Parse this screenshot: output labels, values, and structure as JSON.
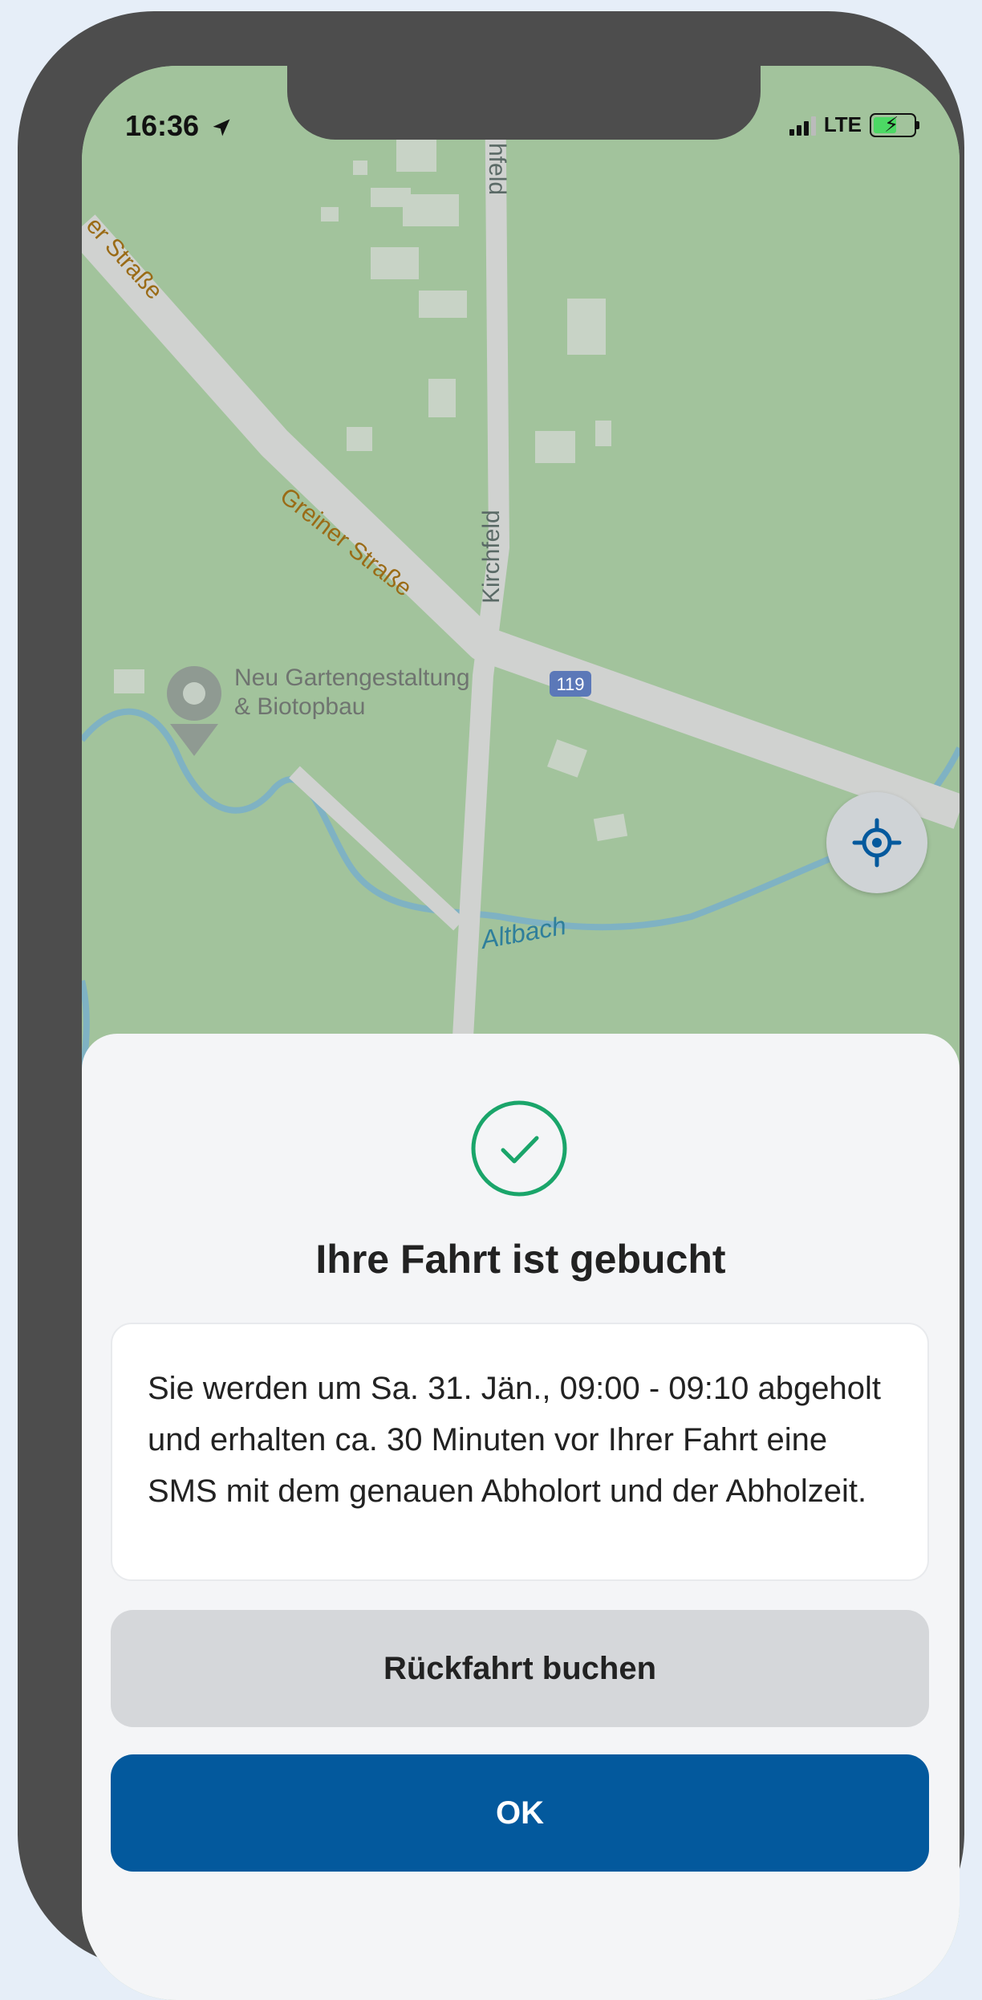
{
  "status_bar": {
    "time": "16:36",
    "network": "LTE"
  },
  "map": {
    "labels": {
      "street_1": "er Straße",
      "street_2": "Greiner Straße",
      "street_3": "Kirchfeld",
      "street_4": "hfeld",
      "poi_line1": "Neu Gartengestaltung",
      "poi_line2": "& Biotopbau",
      "route_badge": "119",
      "creek": "Altbach"
    },
    "colors": {
      "land": "#a2c39c",
      "road": "#d0d2d0",
      "water": "#7fb2c3",
      "building": "#c8d3c6"
    }
  },
  "icons": {
    "locate": "crosshair-location-icon",
    "success": "check-circle-icon",
    "location_arrow": "location-arrow-icon"
  },
  "confirmation": {
    "title": "Ihre Fahrt ist gebucht",
    "message": "Sie werden um Sa. 31. Jän., 09:00 - 09:10 abgeholt und erhalten ca. 30 Minuten vor Ihrer Fahrt eine SMS mit dem genauen Abholort und der Abholzeit."
  },
  "buttons": {
    "return_trip": "Rückfahrt buchen",
    "ok": "OK"
  },
  "colors": {
    "primary": "#03599d",
    "success": "#1aa56a",
    "secondary_button": "#d5d7da"
  }
}
